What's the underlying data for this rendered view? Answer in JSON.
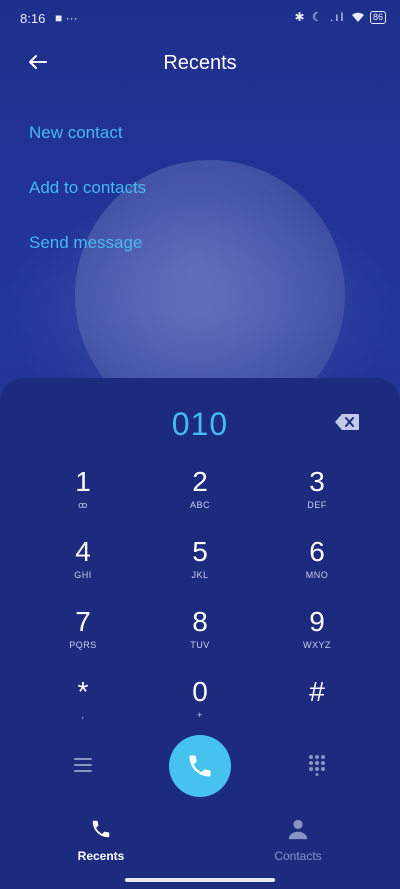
{
  "status": {
    "time": "8:16",
    "left_icons": "■ ···",
    "right_icons": "✱ ☾ .ıl",
    "battery": "86"
  },
  "header": {
    "title": "Recents",
    "back_icon": "arrow-left-icon"
  },
  "actions": [
    "New contact",
    "Add to contacts",
    "Send message"
  ],
  "dialer": {
    "number": "010",
    "keys": [
      {
        "digit": "1",
        "sub": "ꝏ"
      },
      {
        "digit": "2",
        "sub": "ABC"
      },
      {
        "digit": "3",
        "sub": "DEF"
      },
      {
        "digit": "4",
        "sub": "GHI"
      },
      {
        "digit": "5",
        "sub": "JKL"
      },
      {
        "digit": "6",
        "sub": "MNO"
      },
      {
        "digit": "7",
        "sub": "PQRS"
      },
      {
        "digit": "8",
        "sub": "TUV"
      },
      {
        "digit": "9",
        "sub": "WXYZ"
      },
      {
        "digit": "*",
        "sub": ","
      },
      {
        "digit": "0",
        "sub": "+"
      },
      {
        "digit": "#",
        "sub": ""
      }
    ]
  },
  "bottom_nav": [
    {
      "label": "Recents",
      "active": true
    },
    {
      "label": "Contacts",
      "active": false
    }
  ],
  "colors": {
    "accent": "#45b9f2",
    "call": "#45c3ee",
    "pad": "#1d2b7e",
    "inactive": "#8a93c6"
  }
}
